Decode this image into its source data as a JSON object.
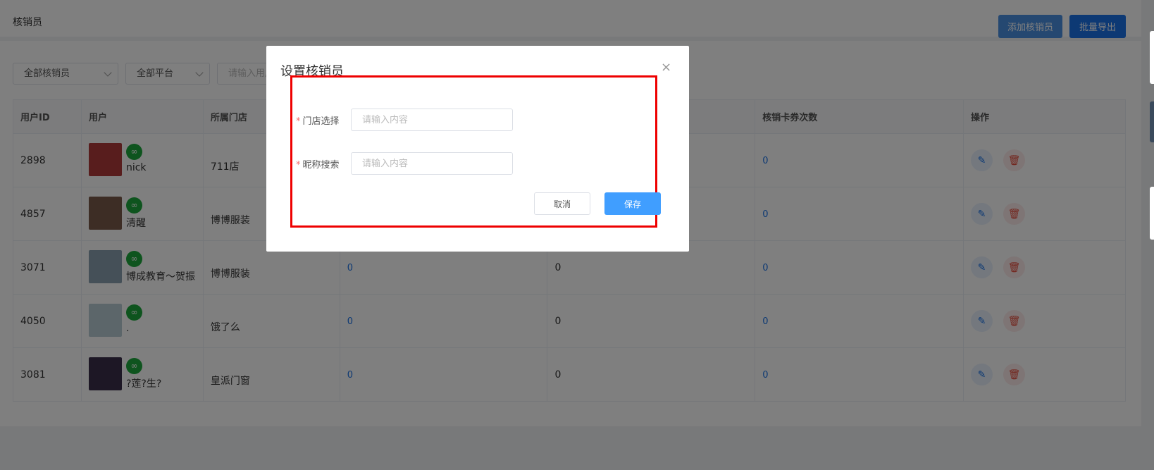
{
  "header": {
    "title": "核销员",
    "add_button": "添加核销员",
    "export_button": "批量导出"
  },
  "filters": {
    "verifier_select": "全部核销员",
    "platform_select": "全部平台",
    "user_input_placeholder": "请输入用户"
  },
  "table": {
    "columns": [
      "用户ID",
      "用户",
      "所属门店",
      "",
      "",
      "核销卡券次数",
      "操作"
    ],
    "rows": [
      {
        "id": "2898",
        "name": "nick",
        "store": "711店",
        "c4": "",
        "c5": "",
        "count": "0"
      },
      {
        "id": "4857",
        "name": "清醒",
        "store": "博博服装",
        "c4": "",
        "c5": "",
        "count": "0"
      },
      {
        "id": "3071",
        "name": "博成教育～贺振",
        "store": "博博服装",
        "c4": "0",
        "c5": "0",
        "count": "0"
      },
      {
        "id": "4050",
        "name": ".",
        "store": "饿了么",
        "c4": "0",
        "c5": "0",
        "count": "0"
      },
      {
        "id": "3081",
        "name": "?莲?生?",
        "store": "皇派门窗",
        "c4": "0",
        "c5": "0",
        "count": "0"
      }
    ],
    "badge_icon": "mini-program-icon",
    "edit_icon": "pencil-icon",
    "delete_icon": "trash-icon"
  },
  "dialog": {
    "title": "设置核销员",
    "close_icon": "×",
    "store_label": "门店选择",
    "store_placeholder": "请输入内容",
    "nickname_label": "昵称搜索",
    "nickname_placeholder": "请输入内容",
    "required_mark": "*",
    "cancel_button": "取消",
    "save_button": "保存"
  },
  "colors": {
    "primary": "#1a73e8",
    "save": "#409eff",
    "danger": "#e74c3c",
    "badge": "#1ca83c",
    "highlight_box": "#e00000"
  }
}
